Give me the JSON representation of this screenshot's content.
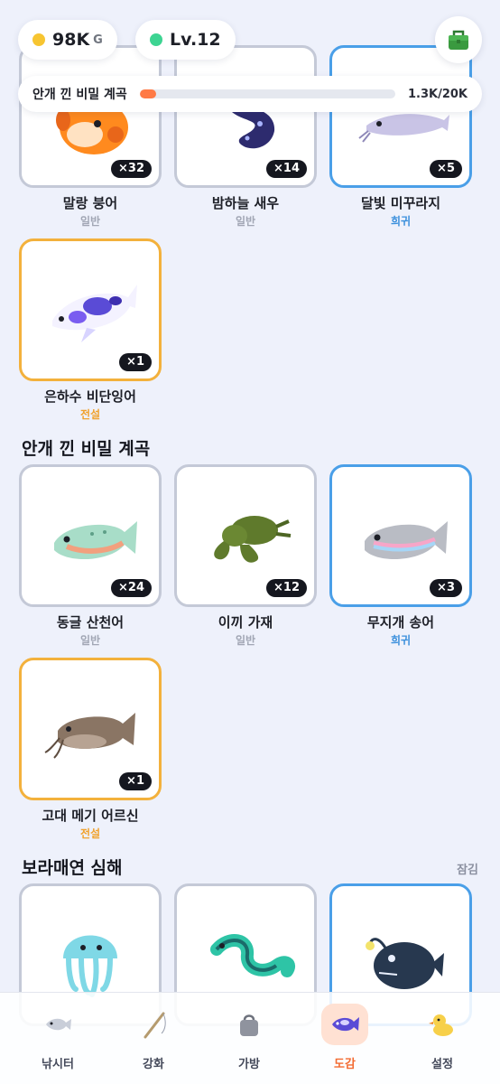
{
  "hud": {
    "gold_value": "98K",
    "gold_unit": "G",
    "level": "Lv.12",
    "gold_color": "#f7c531",
    "level_color": "#3dd492",
    "bag_icon": "green-tackle-box-icon"
  },
  "area_progress": {
    "label": "안개 낀 비밀 계곡",
    "text": "1.3K/20K",
    "fraction": 0.065,
    "fill_color": "#ff7a45"
  },
  "sections": [
    {
      "title": "",
      "items": [
        {
          "name": "말랑 붕어",
          "rarity": "일반",
          "count": "×32",
          "tier": "common"
        },
        {
          "name": "밤하늘 새우",
          "rarity": "일반",
          "count": "×14",
          "tier": "common"
        },
        {
          "name": "달빛 미꾸라지",
          "rarity": "희귀",
          "count": "×5",
          "tier": "rare"
        },
        {
          "name": "은하수 비단잉어",
          "rarity": "전설",
          "count": "×1",
          "tier": "legend"
        }
      ]
    },
    {
      "title": "안개 낀 비밀 계곡",
      "items": [
        {
          "name": "동글 산천어",
          "rarity": "일반",
          "count": "×24",
          "tier": "common"
        },
        {
          "name": "이끼 가재",
          "rarity": "일반",
          "count": "×12",
          "tier": "common"
        },
        {
          "name": "무지개 송어",
          "rarity": "희귀",
          "count": "×3",
          "tier": "rare"
        },
        {
          "name": "고대 메기 어르신",
          "rarity": "전설",
          "count": "×1",
          "tier": "legend"
        }
      ]
    },
    {
      "title": "보라매연 심해",
      "status": "잠김",
      "items": [
        {
          "name": "",
          "tier": "common",
          "icon": "jellyfish-icon"
        },
        {
          "name": "",
          "tier": "common",
          "icon": "eel-icon"
        },
        {
          "name": "",
          "tier": "rare",
          "icon": "anglerfish-icon"
        }
      ]
    }
  ],
  "nav": {
    "items": [
      {
        "label": "낚시터",
        "icon": "fish-icon"
      },
      {
        "label": "강화",
        "icon": "fishing-rod-icon"
      },
      {
        "label": "가방",
        "icon": "bag-icon"
      },
      {
        "label": "도감",
        "icon": "encyclopedia-fish-icon",
        "active": true
      },
      {
        "label": "설정",
        "icon": "duck-icon"
      }
    ]
  }
}
